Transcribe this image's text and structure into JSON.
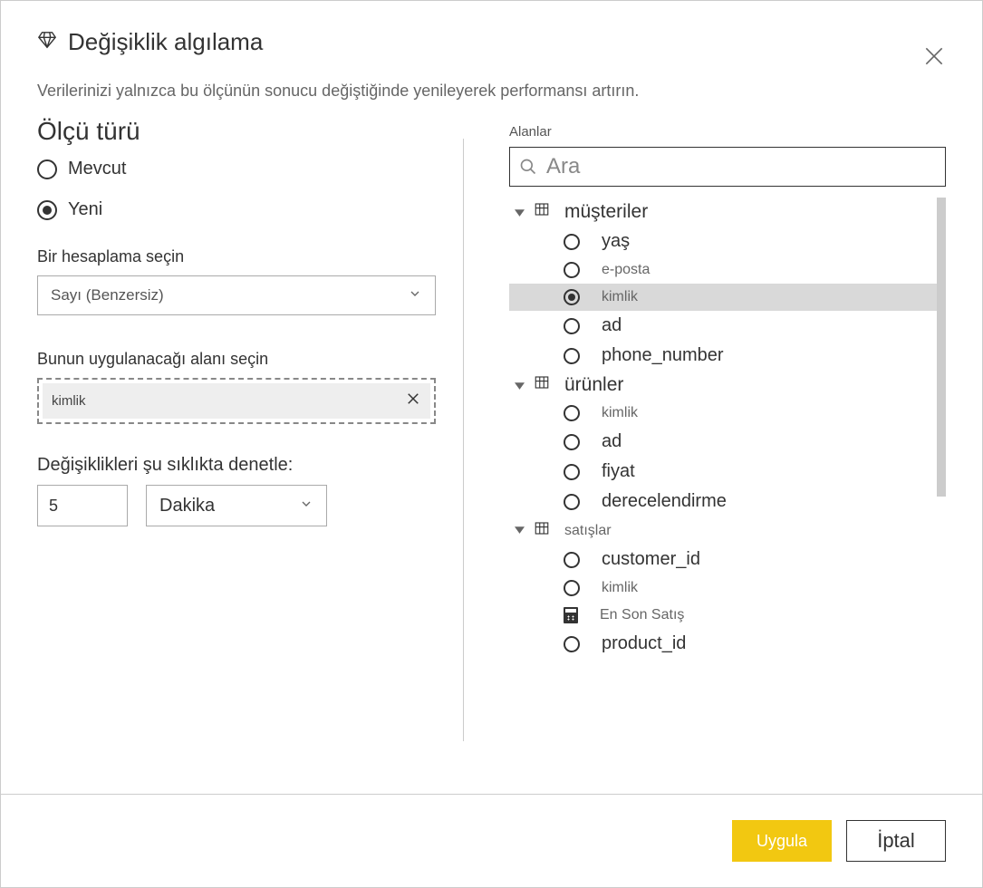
{
  "header": {
    "title": "Değişiklik algılama",
    "subtitle": "Verilerinizi yalnızca bu ölçünün sonucu değiştiğinde yenileyerek performansı artırın."
  },
  "measureType": {
    "title": "Ölçü türü",
    "options": {
      "existing": "Mevcut",
      "new": "Yeni"
    },
    "selected": "new"
  },
  "calculation": {
    "label": "Bir hesaplama seçin",
    "value": "Sayı (Benzersiz)"
  },
  "applyField": {
    "label": "Bunun uygulanacağı alanı seçin",
    "value": "kimlik"
  },
  "interval": {
    "label": "Değişiklikleri şu sıklıkta denetle:",
    "value": "5",
    "unit": "Dakika"
  },
  "fields": {
    "label": "Alanlar",
    "searchPlaceholder": "Ara",
    "tables": [
      {
        "name": "müşteriler",
        "size": "large",
        "fields": [
          {
            "name": "yaş",
            "type": "radio",
            "selected": false,
            "size": "large"
          },
          {
            "name": "e-posta",
            "type": "radio",
            "selected": false,
            "size": "small"
          },
          {
            "name": "kimlik",
            "type": "radio",
            "selected": true,
            "size": "small"
          },
          {
            "name": "ad",
            "type": "radio",
            "selected": false,
            "size": "large"
          },
          {
            "name": "phone_number",
            "type": "radio",
            "selected": false,
            "size": "large"
          }
        ]
      },
      {
        "name": "ürünler",
        "size": "large",
        "fields": [
          {
            "name": "kimlik",
            "type": "radio",
            "selected": false,
            "size": "small"
          },
          {
            "name": "ad",
            "type": "radio",
            "selected": false,
            "size": "large"
          },
          {
            "name": "fiyat",
            "type": "radio",
            "selected": false,
            "size": "large"
          },
          {
            "name": "derecelendirme",
            "type": "radio",
            "selected": false,
            "size": "large"
          }
        ]
      },
      {
        "name": "satışlar",
        "size": "small",
        "fields": [
          {
            "name": "customer_id",
            "type": "radio",
            "selected": false,
            "size": "large"
          },
          {
            "name": "kimlik",
            "type": "radio",
            "selected": false,
            "size": "small"
          },
          {
            "name": "En Son Satış",
            "type": "calc",
            "selected": false,
            "size": "small"
          },
          {
            "name": "product_id",
            "type": "radio",
            "selected": false,
            "size": "large"
          }
        ]
      }
    ]
  },
  "footer": {
    "apply": "Uygula",
    "cancel": "İptal"
  }
}
